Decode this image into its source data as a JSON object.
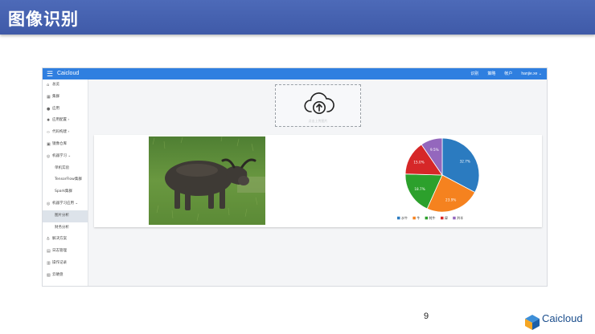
{
  "slide": {
    "title": "图像识别",
    "page_number": "9"
  },
  "app": {
    "brand": "Caicloud",
    "nav": [
      "识别",
      "策略",
      "帐户",
      "hanjie.xe ⌄"
    ],
    "sidebar": [
      {
        "label": "总览",
        "icon": "home-icon",
        "sub": false,
        "active": false
      },
      {
        "label": "集群",
        "icon": "cluster-icon",
        "sub": false,
        "active": false
      },
      {
        "label": "应用",
        "icon": "app-icon",
        "sub": false,
        "active": false
      },
      {
        "label": "应用配置 ›",
        "icon": "config-icon",
        "sub": false,
        "active": false
      },
      {
        "label": "代码构建 ›",
        "icon": "code-icon",
        "sub": false,
        "active": false
      },
      {
        "label": "镜像仓库",
        "icon": "repo-icon",
        "sub": false,
        "active": false
      },
      {
        "label": "机器学习 ⌄",
        "icon": "ml-icon",
        "sub": false,
        "active": false
      },
      {
        "label": "单机实验",
        "icon": "",
        "sub": true,
        "active": false
      },
      {
        "label": "TensorFlow集群",
        "icon": "",
        "sub": true,
        "active": false
      },
      {
        "label": "Spark集群",
        "icon": "",
        "sub": true,
        "active": false
      },
      {
        "label": "机器学习应用 ⌄",
        "icon": "ml-app-icon",
        "sub": false,
        "active": false
      },
      {
        "label": "图片分析",
        "icon": "",
        "sub": true,
        "active": true
      },
      {
        "label": "财务分析",
        "icon": "",
        "sub": true,
        "active": false
      },
      {
        "label": "解决方案",
        "icon": "solution-icon",
        "sub": false,
        "active": false
      },
      {
        "label": "日志管理",
        "icon": "log-icon",
        "sub": false,
        "active": false
      },
      {
        "label": "操作记录",
        "icon": "record-icon",
        "sub": false,
        "active": false
      },
      {
        "label": "云硬盘",
        "icon": "disk-icon",
        "sub": false,
        "active": false
      }
    ],
    "upload": {
      "hint": "点击上传图片",
      "icon": "cloud-upload-icon"
    }
  },
  "colors": {
    "header": "#4560b0",
    "topbar": "#2f7fe0"
  },
  "chart_data": {
    "type": "pie",
    "slices": [
      {
        "label": "水牛",
        "value": 32.7,
        "color": "#2b7bc0",
        "value_label": "32.7%"
      },
      {
        "label": "牛",
        "value": 23.9,
        "color": "#f5821f",
        "value_label": "23.9%"
      },
      {
        "label": "牦牛",
        "value": 18.7,
        "color": "#2ca02c",
        "value_label": "18.7%"
      },
      {
        "label": "犀",
        "value": 15.0,
        "color": "#d62728",
        "value_label": "15.0%"
      },
      {
        "label": "羚羊",
        "value": 9.5,
        "color": "#9467bd",
        "value_label": "9.5%"
      }
    ],
    "legend_position": "bottom"
  },
  "logo": {
    "text": "Caicloud"
  }
}
